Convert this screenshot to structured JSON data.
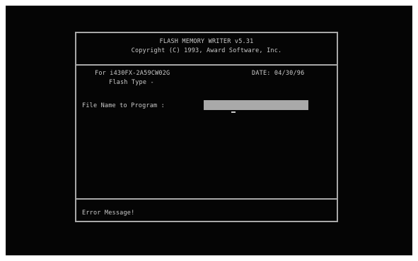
{
  "window": {
    "title": "FLASH MEMORY WRITER v5.31",
    "copyright": "Copyright (C) 1993, Award Software, Inc."
  },
  "info": {
    "for_label": "For i430FX-2A59CW02G",
    "date_label": "DATE: 04/30/96",
    "flash_type_label": "Flash Type -"
  },
  "prompt": {
    "file_name_label": "File Name to Program :",
    "file_name_value": ""
  },
  "footer": {
    "error_label": "Error Message!"
  },
  "colors": {
    "background": "#050505",
    "border": "#a8a8a8",
    "text": "#c9c9c9",
    "input_bg": "#a9a9a9"
  }
}
